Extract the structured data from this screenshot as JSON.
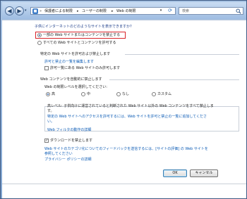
{
  "toolbar": {
    "back_icon": "back-arrow-icon",
    "forward_icon": "forward-arrow-icon"
  },
  "address": {
    "crumbs": [
      "保護者による制限",
      "ユーザーの制限",
      "Web の制限"
    ]
  },
  "search": {
    "placeholder": "検索"
  },
  "page": {
    "title": "子供にインターネットのどのようなサイトを表示できますか?",
    "option_block_some": "一部の Web サイトまたはコンテンツを禁止する",
    "option_allow_all": "すべての Web サイトとコンテンツを許可する",
    "allow_block_header": "特定の Web サイトを許可および禁止します",
    "edit_list_link": "許可と禁止の一覧を編集します",
    "only_allowed_check": "許可一覧にある Web サイトのみ許可します",
    "auto_block_header": "Web コンテンツを自動的に禁止します",
    "choose_level": "Web の制限レベルを選択してください:",
    "levels": [
      "高",
      "中",
      "なし",
      "カスタム"
    ],
    "desc_line1": "高レベル: 子供向けに運営されていると判断された Web サイト以外の Web コンテンツをすべて禁止しま",
    "desc_line2": "す。",
    "desc_link": "特定の Web サイトへのアクセスを許可するには、Web サイトを許可と禁止の一覧に追加してくださ",
    "desc_link2": "い。",
    "filter_link": "Web フィルタの動作の詳細",
    "block_downloads": "ダウンロードを禁止します",
    "feedback_link1": "Web サイトのカテゴリ化についてのフィードバックを送信するには、[サイトの評価] の Web サイトを",
    "feedback_link2": "参照してください",
    "privacy_link": "プライバシー ポリシーの詳細"
  },
  "buttons": {
    "ok": "OK",
    "cancel": "キャンセル"
  }
}
